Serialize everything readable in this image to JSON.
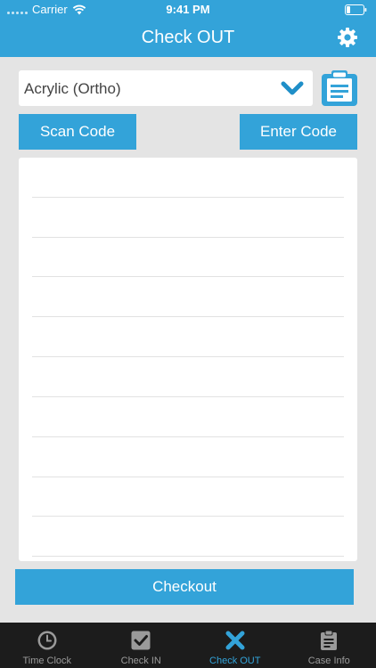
{
  "status_bar": {
    "carrier": "Carrier",
    "time": "9:41 PM"
  },
  "header": {
    "title": "Check OUT",
    "settings_icon": "gear-icon"
  },
  "material_select": {
    "value": "Acrylic (Ortho)",
    "icon": "chevron-down-icon"
  },
  "clipboard_icon": "clipboard-icon",
  "buttons": {
    "scan_code": "Scan Code",
    "enter_code": "Enter Code",
    "checkout": "Checkout"
  },
  "tabs": [
    {
      "label": "Time Clock",
      "icon": "clock-icon",
      "active": false
    },
    {
      "label": "Check IN",
      "icon": "check-square-icon",
      "active": false
    },
    {
      "label": "Check OUT",
      "icon": "x-icon",
      "active": true
    },
    {
      "label": "Case Info",
      "icon": "clipboard-icon",
      "active": false
    }
  ],
  "colors": {
    "accent": "#33a3d9",
    "tabbar": "#1c1c1c",
    "background": "#e4e4e4",
    "inactive_tab": "#9a9a9a"
  }
}
